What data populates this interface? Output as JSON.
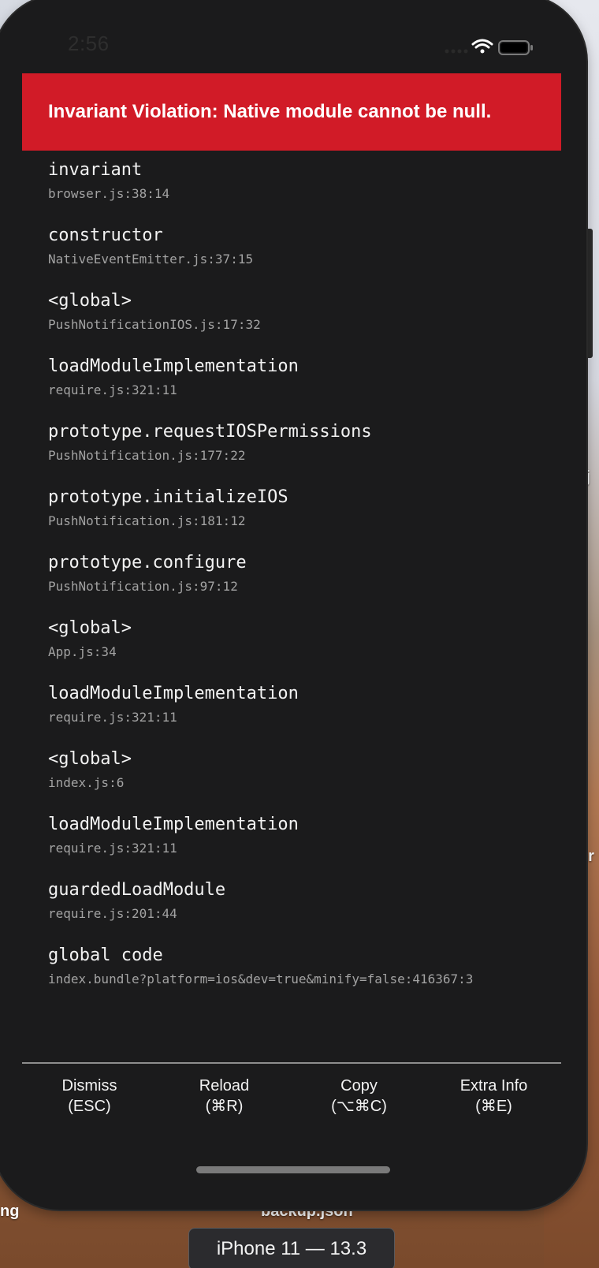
{
  "status_bar": {
    "time": "2:56"
  },
  "error": {
    "title": "Invariant Violation: Native module cannot be null."
  },
  "stack": [
    {
      "method": "invariant",
      "location": "browser.js:38:14"
    },
    {
      "method": "constructor",
      "location": "NativeEventEmitter.js:37:15"
    },
    {
      "method": "<global>",
      "location": "PushNotificationIOS.js:17:32"
    },
    {
      "method": "loadModuleImplementation",
      "location": "require.js:321:11"
    },
    {
      "method": "prototype.requestIOSPermissions",
      "location": "PushNotification.js:177:22"
    },
    {
      "method": "prototype.initializeIOS",
      "location": "PushNotification.js:181:12"
    },
    {
      "method": "prototype.configure",
      "location": "PushNotification.js:97:12"
    },
    {
      "method": "<global>",
      "location": "App.js:34"
    },
    {
      "method": "loadModuleImplementation",
      "location": "require.js:321:11"
    },
    {
      "method": "<global>",
      "location": "index.js:6"
    },
    {
      "method": "loadModuleImplementation",
      "location": "require.js:321:11"
    },
    {
      "method": "guardedLoadModule",
      "location": "require.js:201:44"
    },
    {
      "method": "global code",
      "location": "index.bundle?platform=ios&dev=true&minify=false:416367:3"
    }
  ],
  "buttons": [
    {
      "label": "Dismiss",
      "shortcut": "(ESC)"
    },
    {
      "label": "Reload",
      "shortcut": "(⌘R)"
    },
    {
      "label": "Copy",
      "shortcut": "(⌥⌘C)"
    },
    {
      "label": "Extra Info",
      "shortcut": "(⌘E)"
    }
  ],
  "desktop": {
    "file_label": "backup.json",
    "left_label": "ng",
    "right_label_1": "oj",
    "right_label_2": "er"
  },
  "simulator": {
    "device_label": "iPhone 11 — 13.3"
  },
  "colors": {
    "banner": "#d11b27",
    "background": "#1b1b1c"
  }
}
